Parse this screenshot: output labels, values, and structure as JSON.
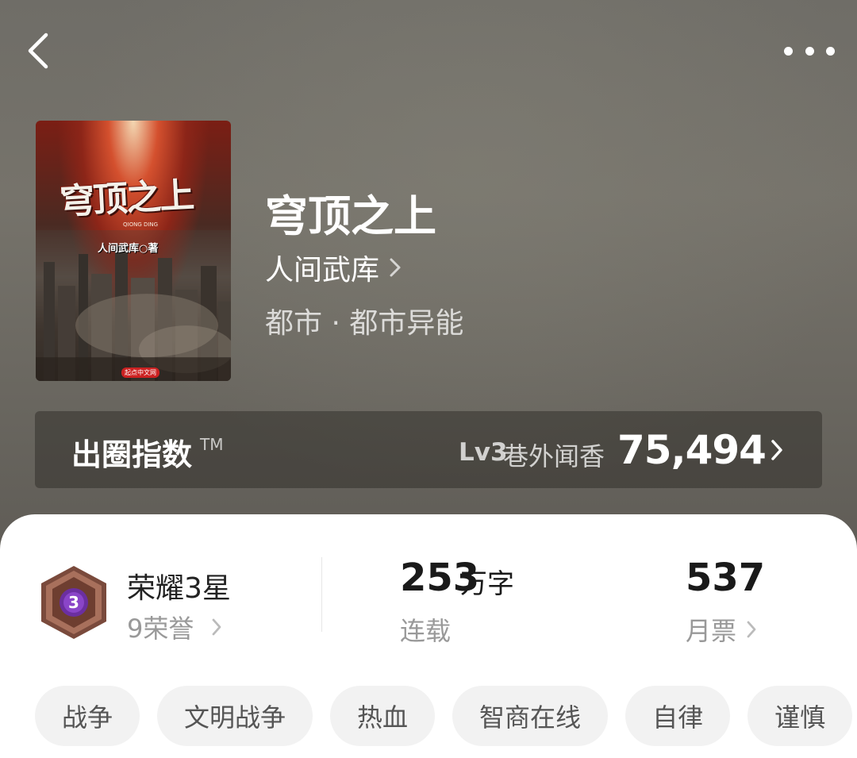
{
  "header": {
    "back_icon": "chevron-left-icon",
    "more_icon": "more-dots-icon"
  },
  "book": {
    "title": "穹顶之上",
    "author": "人间武库",
    "genre": "都市 · 都市异能",
    "cover": {
      "title_text": "穹顶之上",
      "subtitle_text": "QIONG DING",
      "author_text": "人间武库○著",
      "publisher_badge": "起点中文网"
    }
  },
  "index": {
    "label": "出圈指数",
    "tm": "TM",
    "level": "Lv3",
    "level_name": "巷外闻香",
    "value": "75,494"
  },
  "stats": {
    "honor": {
      "title": "荣耀3星",
      "subtitle": "9荣誉",
      "badge_number": "3"
    },
    "words": {
      "value": "253",
      "unit": "万字",
      "status": "连载"
    },
    "monthly_ticket": {
      "value": "537",
      "label": "月票"
    }
  },
  "tags": [
    "战争",
    "文明战争",
    "热血",
    "智商在线",
    "自律",
    "谨慎"
  ],
  "colors": {
    "hero_bg": "#6f6d67",
    "card_bg": "#ffffff",
    "tag_bg": "#f2f2f2",
    "badge_primary": "#6b2fa0",
    "badge_frame": "#8a5a4a"
  }
}
